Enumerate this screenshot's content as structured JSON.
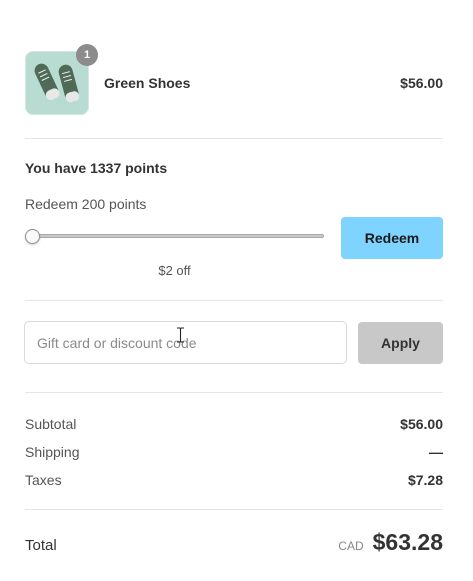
{
  "product": {
    "name": "Green Shoes",
    "price": "$56.00",
    "quantity": "1",
    "image_icon": "shoes-image"
  },
  "points": {
    "title": "You have 1337 points",
    "redeem_label": "Redeem 200 points",
    "discount": "$2 off",
    "slider_value": 0,
    "redeem_button": "Redeem",
    "redeem_button_color": "#7fd4ff"
  },
  "discount": {
    "placeholder": "Gift card or discount code",
    "value": "",
    "apply_button": "Apply"
  },
  "summary": {
    "subtotal_label": "Subtotal",
    "subtotal_value": "$56.00",
    "shipping_label": "Shipping",
    "shipping_value": "—",
    "taxes_label": "Taxes",
    "taxes_value": "$7.28"
  },
  "total": {
    "label": "Total",
    "currency": "CAD",
    "value": "$63.28"
  }
}
